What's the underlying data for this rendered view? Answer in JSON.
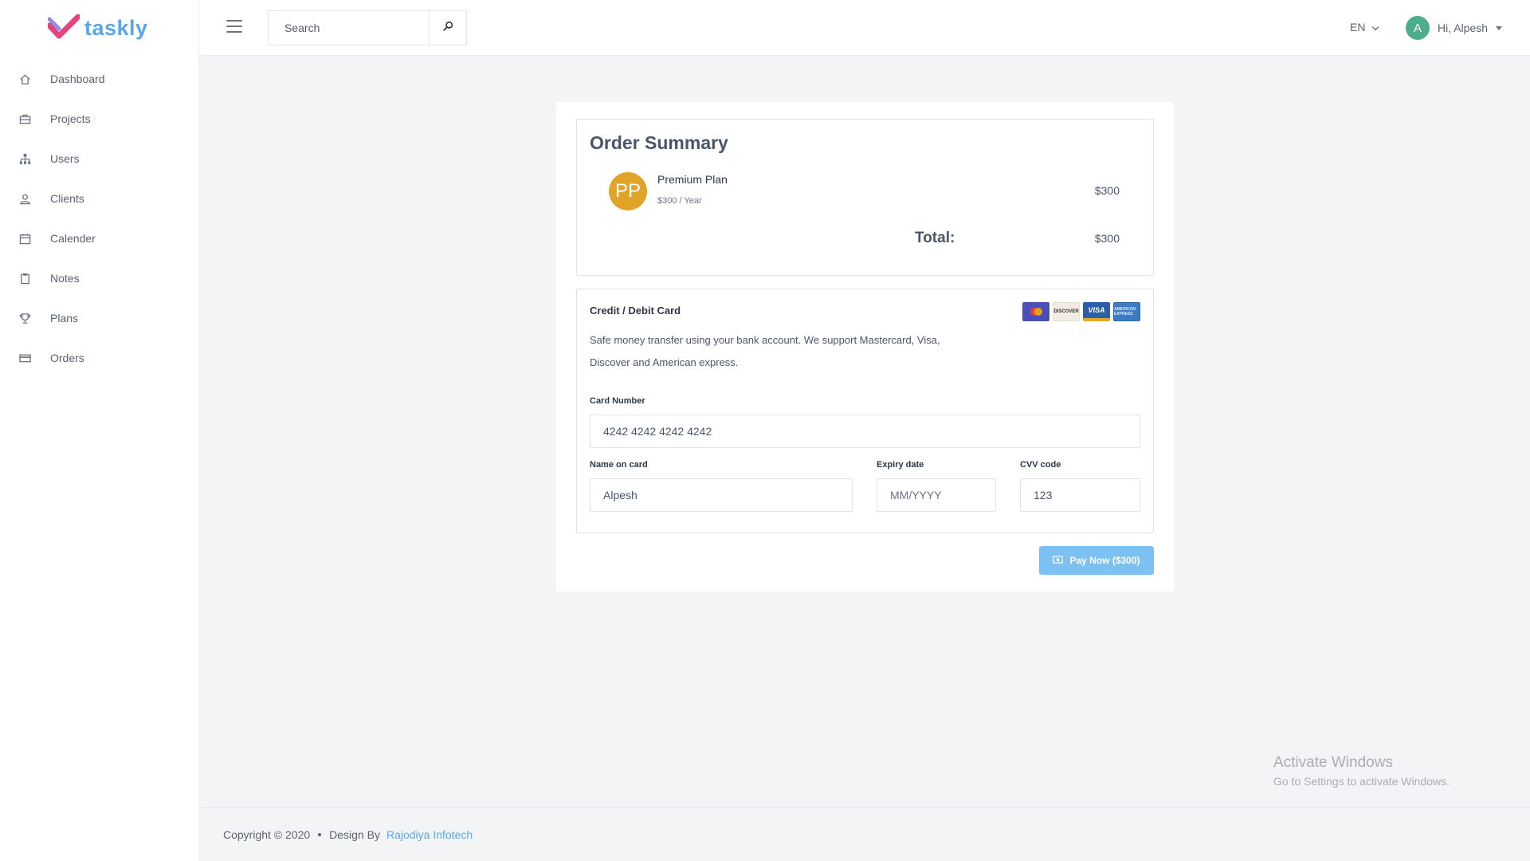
{
  "brand": {
    "name": "taskly"
  },
  "sidebar": {
    "items": [
      {
        "label": "Dashboard",
        "icon": "home-icon"
      },
      {
        "label": "Projects",
        "icon": "briefcase-icon"
      },
      {
        "label": "Users",
        "icon": "sitemap-icon"
      },
      {
        "label": "Clients",
        "icon": "user-icon"
      },
      {
        "label": "Calender",
        "icon": "calendar-icon"
      },
      {
        "label": "Notes",
        "icon": "clipboard-icon"
      },
      {
        "label": "Plans",
        "icon": "trophy-icon"
      },
      {
        "label": "Orders",
        "icon": "credit-card-icon"
      }
    ]
  },
  "header": {
    "search": {
      "placeholder": "Search"
    },
    "language": "EN",
    "user": {
      "initial": "A",
      "greeting": "Hi, Alpesh"
    }
  },
  "order_summary": {
    "title": "Order Summary",
    "plan": {
      "initials": "PP",
      "name": "Premium Plan",
      "billing": "$300 / Year",
      "price": "$300"
    },
    "total_label": "Total:",
    "total_value": "$300"
  },
  "payment": {
    "title": "Credit / Debit Card",
    "description": "Safe money transfer using your bank account. We support Mastercard, Visa, Discover and American express.",
    "card_brands": {
      "discover": "DISCOVER",
      "visa": "VISA",
      "amex": "AMERICAN EXPRESS"
    },
    "card_number": {
      "label": "Card Number",
      "value": "4242 4242 4242 4242"
    },
    "name_on_card": {
      "label": "Name on card",
      "value": "Alpesh"
    },
    "expiry": {
      "label": "Expiry date",
      "placeholder": "MM/YYYY"
    },
    "cvv": {
      "label": "CVV code",
      "value": "123"
    },
    "pay_button": "Pay Now ($300)"
  },
  "watermark": {
    "title": "Activate Windows",
    "subtitle": "Go to Settings to activate Windows."
  },
  "footer": {
    "copyright": "Copyright © 2020",
    "design_by": "Design By",
    "designer": "Rajodiya Infotech"
  },
  "colors": {
    "accent": "#5aa6e6",
    "plan_avatar": "#e1a328",
    "user_avatar": "#4caf8a",
    "pay_button": "#7cc1f2"
  }
}
